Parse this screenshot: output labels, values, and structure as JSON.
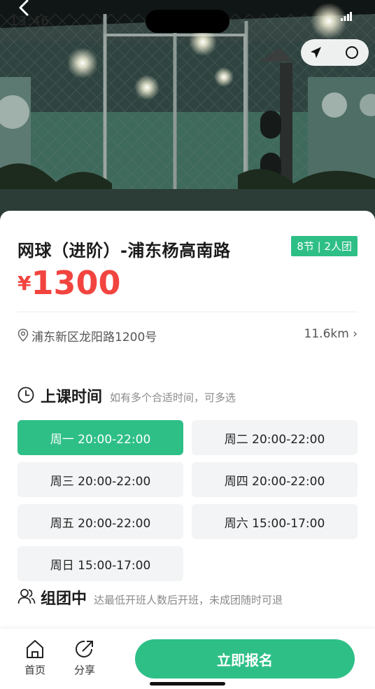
{
  "status_bar": {
    "time": "13:46"
  },
  "course": {
    "title": "网球（进阶）-浦东杨高南路",
    "badge": "8节 | 2人团",
    "currency": "¥",
    "price": "1300",
    "address": "浦东新区龙阳路1200号",
    "distance": "11.6km ›"
  },
  "schedule": {
    "title": "上课时间",
    "hint": "如有多个合适时间，可多选",
    "selected_index": 0,
    "slots": [
      "周一 20:00-22:00",
      "周二 20:00-22:00",
      "周三 20:00-22:00",
      "周四 20:00-22:00",
      "周五 20:00-22:00",
      "周六 15:00-17:00",
      "周日 15:00-17:00"
    ]
  },
  "group": {
    "title": "组团中",
    "hint": "达最低开班人数后开班，未成团随时可退"
  },
  "bottom_bar": {
    "home_label": "首页",
    "share_label": "分享",
    "signup_label": "立即报名"
  },
  "colors": {
    "accent": "#2ebf87",
    "price": "#f2443f"
  },
  "icons": {
    "back": "back-arrow-icon",
    "signal": "signal-icon",
    "nav": "navigation-arrow-icon",
    "circle": "target-circle-icon",
    "location": "location-pin-icon",
    "clock": "clock-icon",
    "group": "group-icon",
    "home": "home-icon",
    "share": "share-icon"
  }
}
